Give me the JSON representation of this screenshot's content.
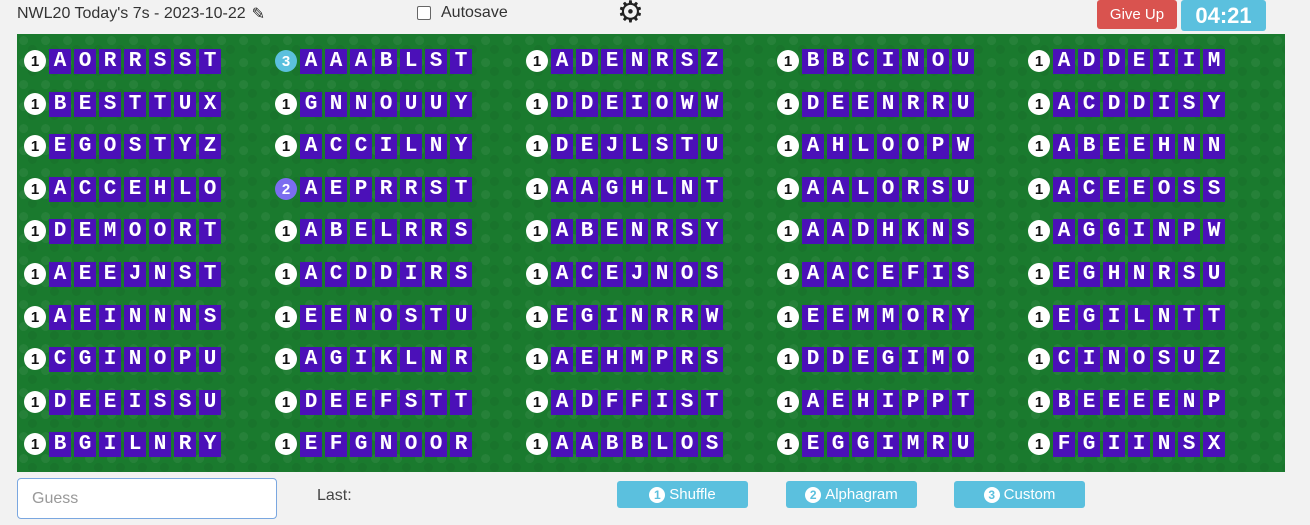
{
  "header": {
    "title": "NWL20 Today's 7s - 2023-10-22",
    "autosave_label": "Autosave",
    "give_up_label": "Give Up",
    "timer": "04:21"
  },
  "board": {
    "columns": [
      [
        {
          "count": "1",
          "letters": "AORRSST"
        },
        {
          "count": "1",
          "letters": "BESTTUX"
        },
        {
          "count": "1",
          "letters": "EGOSTYZ"
        },
        {
          "count": "1",
          "letters": "ACCEHLO"
        },
        {
          "count": "1",
          "letters": "DEMOORT"
        },
        {
          "count": "1",
          "letters": "AEEJNST"
        },
        {
          "count": "1",
          "letters": "AEINNNS"
        },
        {
          "count": "1",
          "letters": "CGINOPU"
        },
        {
          "count": "1",
          "letters": "DEEISSU"
        },
        {
          "count": "1",
          "letters": "BGILNRY"
        }
      ],
      [
        {
          "count": "3",
          "letters": "AAABLST"
        },
        {
          "count": "1",
          "letters": "GNNOUUY"
        },
        {
          "count": "1",
          "letters": "ACCILNY"
        },
        {
          "count": "2",
          "letters": "AEPRRST"
        },
        {
          "count": "1",
          "letters": "ABELRRS"
        },
        {
          "count": "1",
          "letters": "ACDDIRS"
        },
        {
          "count": "1",
          "letters": "EENOSTU"
        },
        {
          "count": "1",
          "letters": "AGIKLNR"
        },
        {
          "count": "1",
          "letters": "DEEFSTT"
        },
        {
          "count": "1",
          "letters": "EFGNOOR"
        }
      ],
      [
        {
          "count": "1",
          "letters": "ADENRSZ"
        },
        {
          "count": "1",
          "letters": "DDEIOWW"
        },
        {
          "count": "1",
          "letters": "DEJLSTU"
        },
        {
          "count": "1",
          "letters": "AAGHLNT"
        },
        {
          "count": "1",
          "letters": "ABENRSY"
        },
        {
          "count": "1",
          "letters": "ACEJNOS"
        },
        {
          "count": "1",
          "letters": "EGINRRW"
        },
        {
          "count": "1",
          "letters": "AEHMPRS"
        },
        {
          "count": "1",
          "letters": "ADFFIST"
        },
        {
          "count": "1",
          "letters": "AABBLOS"
        }
      ],
      [
        {
          "count": "1",
          "letters": "BBCINOU"
        },
        {
          "count": "1",
          "letters": "DEENRRU"
        },
        {
          "count": "1",
          "letters": "AHLOOPW"
        },
        {
          "count": "1",
          "letters": "AALORSU"
        },
        {
          "count": "1",
          "letters": "AADHKNS"
        },
        {
          "count": "1",
          "letters": "AACEFIS"
        },
        {
          "count": "1",
          "letters": "EEMMORY"
        },
        {
          "count": "1",
          "letters": "DDEGIMO"
        },
        {
          "count": "1",
          "letters": "AEHIPPT"
        },
        {
          "count": "1",
          "letters": "EGGIMRU"
        }
      ],
      [
        {
          "count": "1",
          "letters": "ADDEIIM"
        },
        {
          "count": "1",
          "letters": "ACDDISY"
        },
        {
          "count": "1",
          "letters": "ABEEHNN"
        },
        {
          "count": "1",
          "letters": "ACEEOSS"
        },
        {
          "count": "1",
          "letters": "AGGINPW"
        },
        {
          "count": "1",
          "letters": "EGHNRSU"
        },
        {
          "count": "1",
          "letters": "EGILNTT"
        },
        {
          "count": "1",
          "letters": "CINOSUZ"
        },
        {
          "count": "1",
          "letters": "BEEEENP"
        },
        {
          "count": "1",
          "letters": "FGIINSX"
        }
      ]
    ]
  },
  "footer": {
    "guess_placeholder": "Guess",
    "last_label": "Last:",
    "buttons": [
      {
        "num": "1",
        "label": "Shuffle"
      },
      {
        "num": "2",
        "label": "Alphagram"
      },
      {
        "num": "3",
        "label": "Custom"
      }
    ]
  },
  "colors": {
    "board_green": "#1a7a2e",
    "tile_purple": "#4b10b8",
    "accent_blue": "#5bc0de",
    "give_up_red": "#d9534f"
  }
}
